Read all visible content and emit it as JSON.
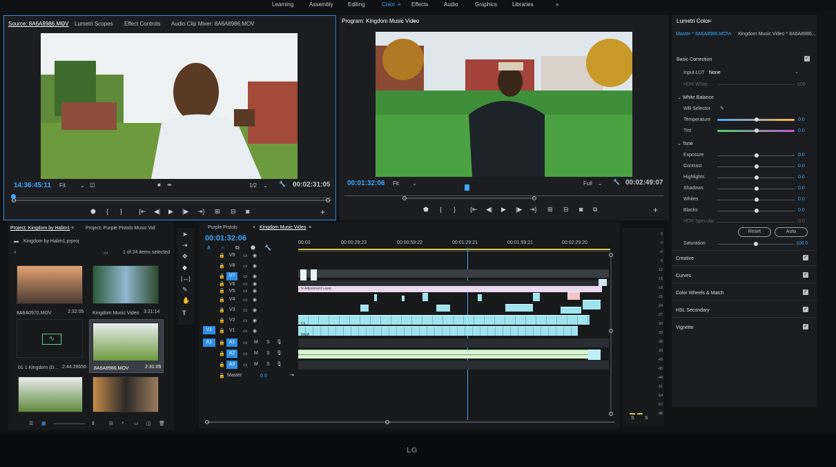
{
  "workspaces": {
    "items": [
      {
        "label": "Learning"
      },
      {
        "label": "Assembly"
      },
      {
        "label": "Editing"
      },
      {
        "label": "Color"
      },
      {
        "label": "Effects"
      },
      {
        "label": "Audio"
      },
      {
        "label": "Graphics"
      },
      {
        "label": "Libraries"
      }
    ],
    "more": "»",
    "active": "Color"
  },
  "source": {
    "tabs": [
      "Source: 8A6A8986.MOV",
      "Lumetri Scopes",
      "Effect Controls",
      "Audio Clip Mixer: 8A6A8986.MOV"
    ],
    "timecode": "14:36:45:11",
    "fit": "Fit",
    "res": "1/2",
    "duration": "00:02:31:05"
  },
  "program": {
    "title": "Program: Kingdom Music Video",
    "timecode": "00:01:32:06",
    "fit": "Fit",
    "quality": "Full",
    "duration": "00:02:49:07"
  },
  "project": {
    "tabs": [
      "Project: Kingdom by Halim1",
      "Project: Purple Pistols Music Vid"
    ],
    "file": "Kingdom by Halim1.prproj",
    "selection": "1 of 24 items selected",
    "items": [
      {
        "name": "8A6A0970.MOV",
        "dur": "2:32:05"
      },
      {
        "name": "Kingdom Music Video",
        "dur": "3:21:14"
      },
      {
        "name": "01 1 Kingdom (D...",
        "dur": "2:44:28656"
      },
      {
        "name": "8A6A8986.MOV",
        "dur": "2:31:05"
      },
      {
        "name": "",
        "dur": ""
      },
      {
        "name": "",
        "dur": ""
      }
    ]
  },
  "timeline": {
    "tabs": [
      "Purple Pistols",
      "Kingdom Music Video"
    ],
    "timecode": "00:01:32:06",
    "ruler": [
      "00:00",
      "00:00:29:23",
      "00:00:59:22",
      "00:01:29:21",
      "00:01:59:21",
      "00:02:29:20"
    ],
    "video_tracks": [
      "V9",
      "V8",
      "V7",
      "V6",
      "V5",
      "V4",
      "V3",
      "V2",
      "V1"
    ],
    "audio_tracks": [
      "A1",
      "A2",
      "A3"
    ],
    "master": "Master",
    "master_val": "0.0",
    "adj_label": "Adjustment Layer",
    "clip1": "Cli...",
    "clip2": "8A6A"
  },
  "meter": {
    "scale": [
      "0",
      "-3",
      "-6",
      "-9",
      "-12",
      "-15",
      "-18",
      "-21",
      "-24",
      "-27",
      "-30",
      "-33",
      "-36",
      "-39",
      "-42",
      "-45",
      "-48",
      "-51",
      "-54",
      "-57",
      "dB"
    ],
    "solo": [
      "S",
      "S"
    ]
  },
  "lumetri": {
    "title": "Lumetri Color",
    "master": "Master * 8A6A8986.MOV",
    "seq": "Kingdom Music Video * 8A6A8986...",
    "basic": "Basic Correction",
    "input_lut_label": "Input LUT",
    "input_lut": "None",
    "hdr_white": "HDR White",
    "hdr_white_val": "100",
    "wb": "White Balance",
    "wb_selector": "WB Selector",
    "temperature": "Temperature",
    "temperature_val": "0.0",
    "tint": "Tint",
    "tint_val": "0.0",
    "tone": "Tone",
    "exposure": "Exposure",
    "exposure_val": "0.0",
    "contrast": "Contrast",
    "contrast_val": "0.0",
    "highlights": "Highlights",
    "highlights_val": "0.0",
    "shadows": "Shadows",
    "shadows_val": "0.0",
    "whites": "Whites",
    "whites_val": "0.0",
    "blacks": "Blacks",
    "blacks_val": "0.0",
    "hdr_specular": "HDR Specular",
    "hdr_specular_val": "0.0",
    "reset": "Reset",
    "auto": "Auto",
    "saturation": "Saturation",
    "saturation_val": "100.0",
    "sections": [
      "Creative",
      "Curves",
      "Color Wheels & Match",
      "HSL Secondary",
      "Vignette"
    ]
  },
  "monitor": {
    "brand": "LG"
  },
  "colors": {
    "accent": "#3da7ff",
    "clip": "#9fe3ef",
    "audio": "#7fd98a",
    "panel": "#1b1d20"
  }
}
